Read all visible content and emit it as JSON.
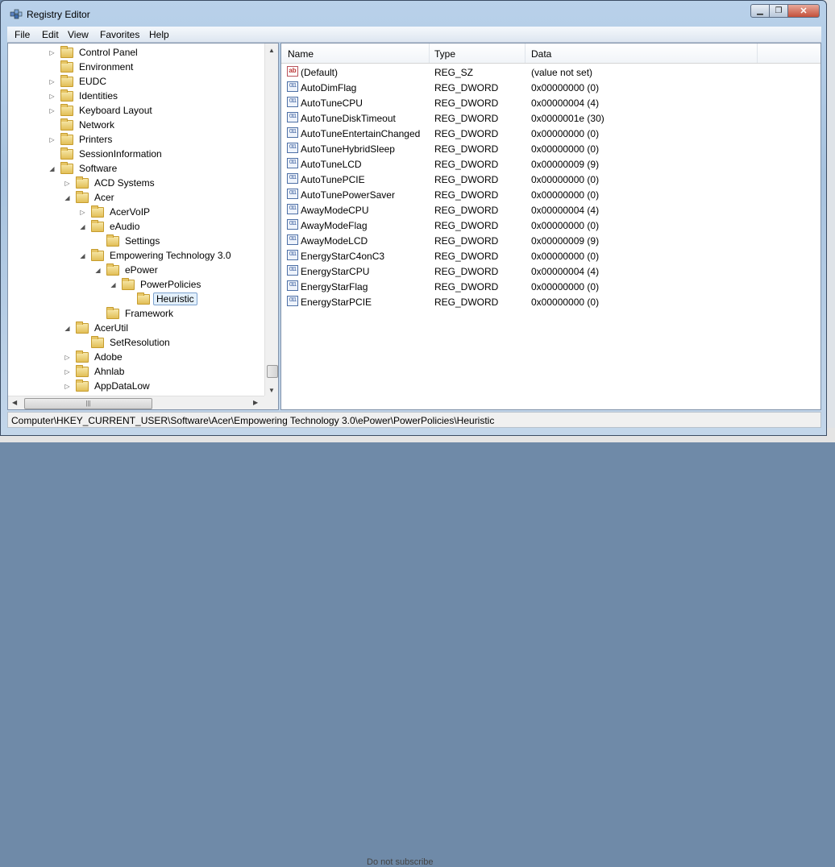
{
  "window": {
    "title": "Registry Editor"
  },
  "menu": [
    "File",
    "Edit",
    "View",
    "Favorites",
    "Help"
  ],
  "tree": [
    {
      "label": "Control Panel",
      "depth": 0,
      "state": "collapsed"
    },
    {
      "label": "Environment",
      "depth": 0,
      "state": "none"
    },
    {
      "label": "EUDC",
      "depth": 0,
      "state": "collapsed"
    },
    {
      "label": "Identities",
      "depth": 0,
      "state": "collapsed"
    },
    {
      "label": "Keyboard Layout",
      "depth": 0,
      "state": "collapsed"
    },
    {
      "label": "Network",
      "depth": 0,
      "state": "none"
    },
    {
      "label": "Printers",
      "depth": 0,
      "state": "collapsed"
    },
    {
      "label": "SessionInformation",
      "depth": 0,
      "state": "none"
    },
    {
      "label": "Software",
      "depth": 0,
      "state": "expanded"
    },
    {
      "label": "ACD Systems",
      "depth": 1,
      "state": "collapsed"
    },
    {
      "label": "Acer",
      "depth": 1,
      "state": "expanded"
    },
    {
      "label": "AcerVoIP",
      "depth": 2,
      "state": "collapsed"
    },
    {
      "label": "eAudio",
      "depth": 2,
      "state": "expanded"
    },
    {
      "label": "Settings",
      "depth": 3,
      "state": "none"
    },
    {
      "label": "Empowering Technology 3.0",
      "depth": 2,
      "state": "expanded"
    },
    {
      "label": "ePower",
      "depth": 3,
      "state": "expanded"
    },
    {
      "label": "PowerPolicies",
      "depth": 4,
      "state": "expanded"
    },
    {
      "label": "Heuristic",
      "depth": 5,
      "state": "none",
      "selected": true
    },
    {
      "label": "Framework",
      "depth": 3,
      "state": "none"
    },
    {
      "label": "AcerUtil",
      "depth": 1,
      "state": "expanded"
    },
    {
      "label": "SetResolution",
      "depth": 2,
      "state": "none"
    },
    {
      "label": "Adobe",
      "depth": 1,
      "state": "collapsed"
    },
    {
      "label": "Ahnlab",
      "depth": 1,
      "state": "collapsed"
    },
    {
      "label": "AppDataLow",
      "depth": 1,
      "state": "collapsed"
    }
  ],
  "columns": [
    "Name",
    "Type",
    "Data"
  ],
  "values": [
    {
      "icon": "string-value-icon",
      "name": "(Default)",
      "type": "REG_SZ",
      "data": "(value not set)"
    },
    {
      "icon": "dword-value-icon",
      "name": "AutoDimFlag",
      "type": "REG_DWORD",
      "data": "0x00000000 (0)"
    },
    {
      "icon": "dword-value-icon",
      "name": "AutoTuneCPU",
      "type": "REG_DWORD",
      "data": "0x00000004 (4)"
    },
    {
      "icon": "dword-value-icon",
      "name": "AutoTuneDiskTimeout",
      "type": "REG_DWORD",
      "data": "0x0000001e (30)"
    },
    {
      "icon": "dword-value-icon",
      "name": "AutoTuneEntertainChanged",
      "type": "REG_DWORD",
      "data": "0x00000000 (0)"
    },
    {
      "icon": "dword-value-icon",
      "name": "AutoTuneHybridSleep",
      "type": "REG_DWORD",
      "data": "0x00000000 (0)"
    },
    {
      "icon": "dword-value-icon",
      "name": "AutoTuneLCD",
      "type": "REG_DWORD",
      "data": "0x00000009 (9)"
    },
    {
      "icon": "dword-value-icon",
      "name": "AutoTunePCIE",
      "type": "REG_DWORD",
      "data": "0x00000000 (0)"
    },
    {
      "icon": "dword-value-icon",
      "name": "AutoTunePowerSaver",
      "type": "REG_DWORD",
      "data": "0x00000000 (0)"
    },
    {
      "icon": "dword-value-icon",
      "name": "AwayModeCPU",
      "type": "REG_DWORD",
      "data": "0x00000004 (4)"
    },
    {
      "icon": "dword-value-icon",
      "name": "AwayModeFlag",
      "type": "REG_DWORD",
      "data": "0x00000000 (0)"
    },
    {
      "icon": "dword-value-icon",
      "name": "AwayModeLCD",
      "type": "REG_DWORD",
      "data": "0x00000009 (9)"
    },
    {
      "icon": "dword-value-icon",
      "name": "EnergyStarC4onC3",
      "type": "REG_DWORD",
      "data": "0x00000000 (0)"
    },
    {
      "icon": "dword-value-icon",
      "name": "EnergyStarCPU",
      "type": "REG_DWORD",
      "data": "0x00000004 (4)"
    },
    {
      "icon": "dword-value-icon",
      "name": "EnergyStarFlag",
      "type": "REG_DWORD",
      "data": "0x00000000 (0)"
    },
    {
      "icon": "dword-value-icon",
      "name": "EnergyStarPCIE",
      "type": "REG_DWORD",
      "data": "0x00000000 (0)"
    }
  ],
  "status": {
    "path": "Computer\\HKEY_CURRENT_USER\\Software\\Acer\\Empowering Technology 3.0\\ePower\\PowerPolicies\\Heuristic"
  },
  "background": {
    "bottom_text": "Do not subscribe"
  },
  "colors": {
    "selection_border": "#7da2ce",
    "selection_fill": "#e3f0fb",
    "title_gradient": "#b9d1ea"
  }
}
